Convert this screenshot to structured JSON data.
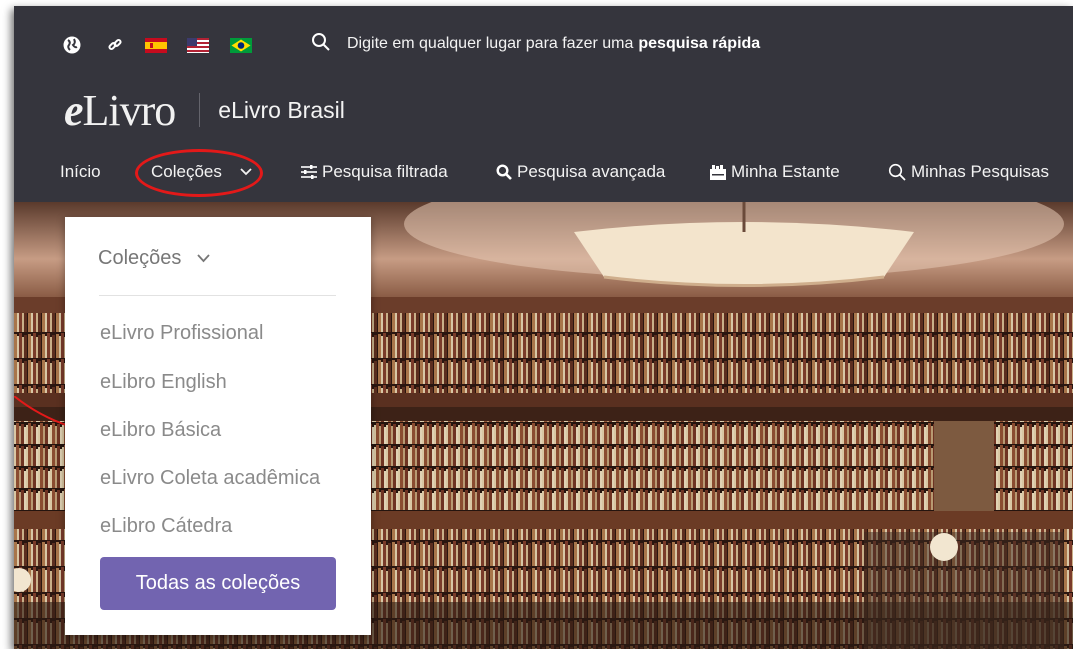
{
  "topbar": {
    "icons": [
      "globe-icon",
      "link-icon"
    ],
    "flags": [
      "spain-flag",
      "usa-flag",
      "brazil-flag"
    ],
    "search": {
      "icon": "search-icon",
      "prefix": "Digite em qualquer lugar para fazer uma",
      "bold": "pesquisa rápida"
    }
  },
  "brand": {
    "logo_e": "e",
    "logo_rest": "Livro",
    "site_name": "eLivro Brasil"
  },
  "nav": {
    "items": [
      {
        "label": "Início"
      },
      {
        "label": "Coleções",
        "icon": "chevron-down-icon"
      },
      {
        "label": "Pesquisa filtrada",
        "icon": "sliders-icon"
      },
      {
        "label": "Pesquisa avançada",
        "icon": "search-icon"
      },
      {
        "label": "Minha Estante",
        "icon": "bookshelf-icon"
      },
      {
        "label": "Minhas Pesquisas",
        "icon": "search-icon"
      }
    ]
  },
  "dropdown": {
    "header": "Coleções",
    "items": [
      "eLivro Profissional",
      "eLibro English",
      "eLibro Básica",
      "eLivro Coleta acadêmica",
      "eLibro Cátedra"
    ],
    "button": "Todas as coleções"
  },
  "colors": {
    "header_bg": "#35353d",
    "accent": "#7264b0",
    "highlight": "#e31919"
  }
}
